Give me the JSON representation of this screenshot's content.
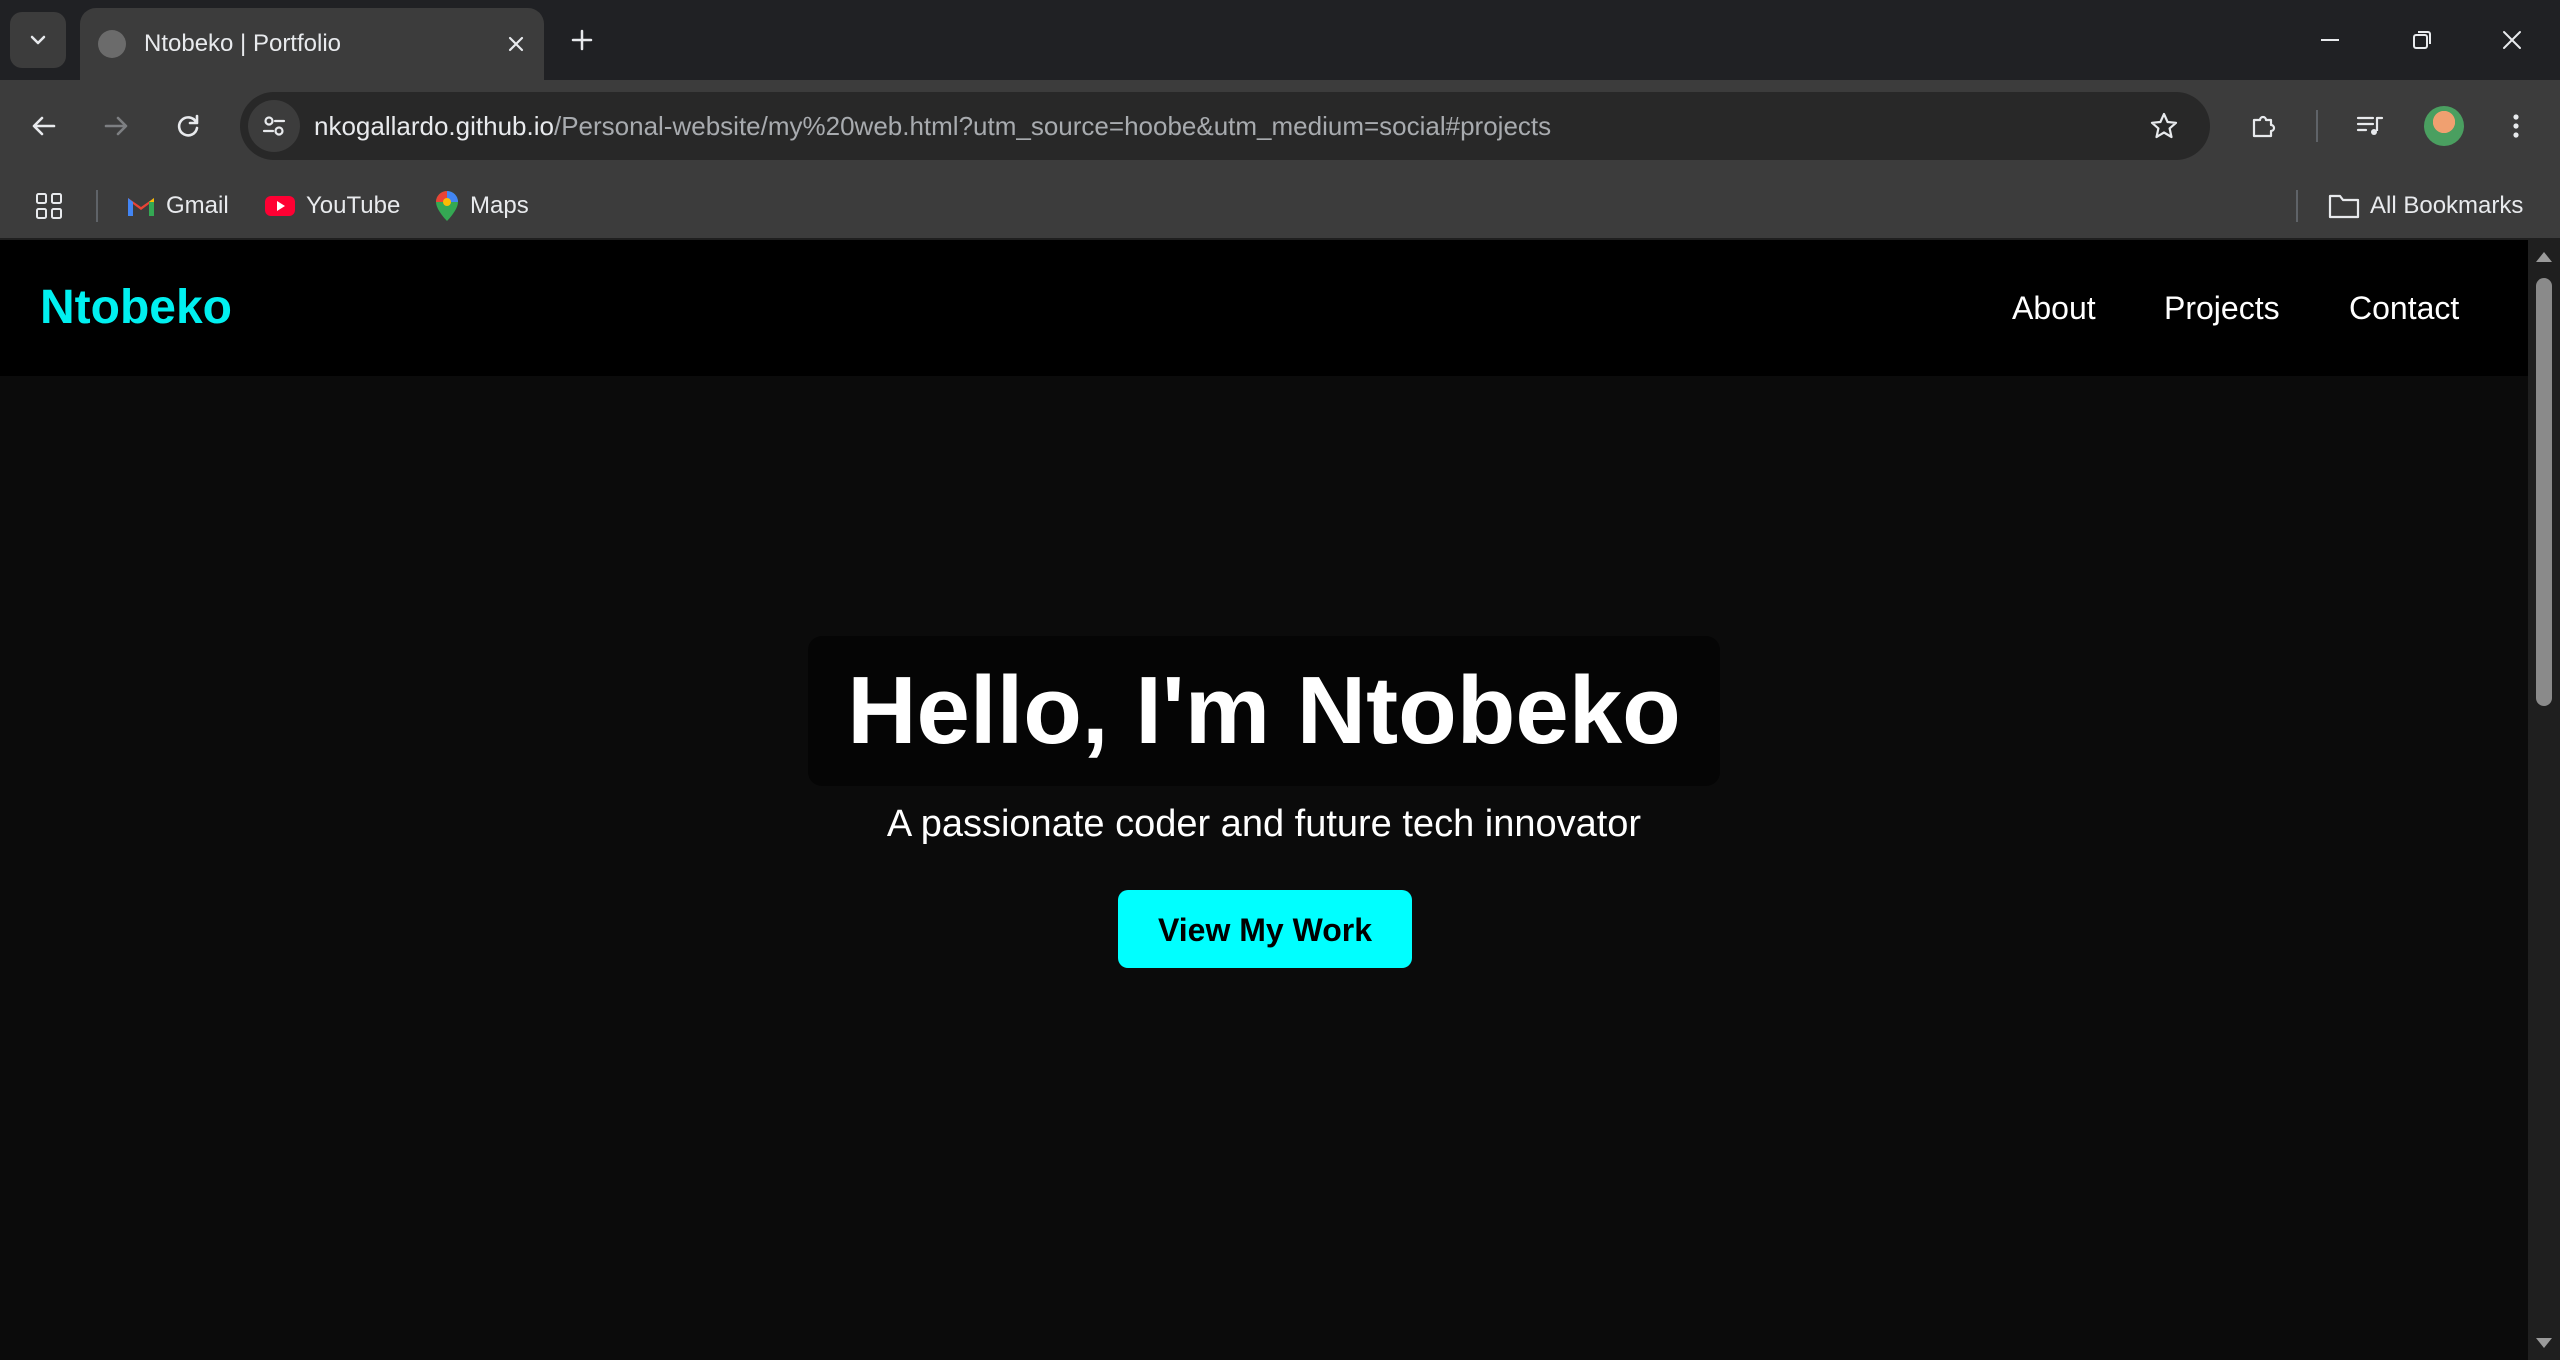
{
  "browser": {
    "tab": {
      "title": "Ntobeko | Portfolio"
    },
    "url": {
      "host": "nkogallardo.github.io",
      "path": "/Personal-website/my%20web.html?utm_source=hoobe&utm_medium=social#projects"
    },
    "bookmarks": [
      {
        "label": "Gmail",
        "icon": "gmail-icon"
      },
      {
        "label": "YouTube",
        "icon": "youtube-icon"
      },
      {
        "label": "Maps",
        "icon": "maps-icon"
      }
    ],
    "all_bookmarks_label": "All Bookmarks"
  },
  "site": {
    "brand": "Ntobeko",
    "nav": [
      "About",
      "Projects",
      "Contact"
    ],
    "hero": {
      "title": "Hello, I'm Ntobeko",
      "subtitle": "A passionate coder and future tech innovator",
      "cta_label": "View My Work"
    }
  },
  "colors": {
    "accent": "#00ffff",
    "brand": "#00f0f0",
    "page_background": "#0b0b0b",
    "nav_background": "#000000",
    "chrome_background": "#3c3c3c",
    "tabstrip_background": "#202124"
  }
}
